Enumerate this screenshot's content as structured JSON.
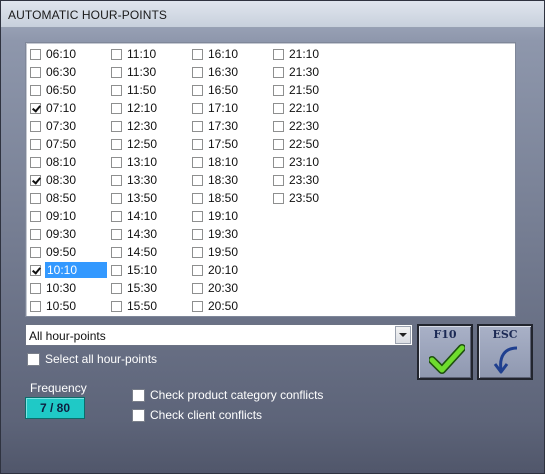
{
  "window": {
    "title": "AUTOMATIC HOUR-POINTS"
  },
  "hour_points": {
    "columns": [
      [
        {
          "time": "06:10",
          "checked": false
        },
        {
          "time": "06:30",
          "checked": false
        },
        {
          "time": "06:50",
          "checked": false
        },
        {
          "time": "07:10",
          "checked": true
        },
        {
          "time": "07:30",
          "checked": false
        },
        {
          "time": "07:50",
          "checked": false
        },
        {
          "time": "08:10",
          "checked": false
        },
        {
          "time": "08:30",
          "checked": true
        },
        {
          "time": "08:50",
          "checked": false
        },
        {
          "time": "09:10",
          "checked": false
        },
        {
          "time": "09:30",
          "checked": false
        },
        {
          "time": "09:50",
          "checked": false
        },
        {
          "time": "10:10",
          "checked": true,
          "selected": true
        },
        {
          "time": "10:30",
          "checked": false
        },
        {
          "time": "10:50",
          "checked": false
        }
      ],
      [
        {
          "time": "11:10",
          "checked": false
        },
        {
          "time": "11:30",
          "checked": false
        },
        {
          "time": "11:50",
          "checked": false
        },
        {
          "time": "12:10",
          "checked": false
        },
        {
          "time": "12:30",
          "checked": false
        },
        {
          "time": "12:50",
          "checked": false
        },
        {
          "time": "13:10",
          "checked": false
        },
        {
          "time": "13:30",
          "checked": false
        },
        {
          "time": "13:50",
          "checked": false
        },
        {
          "time": "14:10",
          "checked": false
        },
        {
          "time": "14:30",
          "checked": false
        },
        {
          "time": "14:50",
          "checked": false
        },
        {
          "time": "15:10",
          "checked": false
        },
        {
          "time": "15:30",
          "checked": false
        },
        {
          "time": "15:50",
          "checked": false
        }
      ],
      [
        {
          "time": "16:10",
          "checked": false
        },
        {
          "time": "16:30",
          "checked": false
        },
        {
          "time": "16:50",
          "checked": false
        },
        {
          "time": "17:10",
          "checked": false
        },
        {
          "time": "17:30",
          "checked": false
        },
        {
          "time": "17:50",
          "checked": false
        },
        {
          "time": "18:10",
          "checked": false
        },
        {
          "time": "18:30",
          "checked": false
        },
        {
          "time": "18:50",
          "checked": false
        },
        {
          "time": "19:10",
          "checked": false
        },
        {
          "time": "19:30",
          "checked": false
        },
        {
          "time": "19:50",
          "checked": false
        },
        {
          "time": "20:10",
          "checked": false
        },
        {
          "time": "20:30",
          "checked": false
        },
        {
          "time": "20:50",
          "checked": false
        }
      ],
      [
        {
          "time": "21:10",
          "checked": false
        },
        {
          "time": "21:30",
          "checked": false
        },
        {
          "time": "21:50",
          "checked": false
        },
        {
          "time": "22:10",
          "checked": false
        },
        {
          "time": "22:30",
          "checked": false
        },
        {
          "time": "22:50",
          "checked": false
        },
        {
          "time": "23:10",
          "checked": false
        },
        {
          "time": "23:30",
          "checked": false
        },
        {
          "time": "23:50",
          "checked": false
        }
      ]
    ]
  },
  "filter": {
    "selected": "All hour-points"
  },
  "select_all": {
    "label": "Select all hour-points",
    "checked": false
  },
  "frequency": {
    "label": "Frequency",
    "value": "7 / 80"
  },
  "options": {
    "product_conflicts": {
      "label": "Check product category conflicts",
      "checked": false
    },
    "client_conflicts": {
      "label": "Check client conflicts",
      "checked": false
    }
  },
  "buttons": {
    "ok": {
      "key": "F10",
      "icon": "checkmark-icon",
      "icon_color": "#5fcf2a"
    },
    "cancel": {
      "key": "ESC",
      "icon": "undo-arrow-icon",
      "icon_color": "#1f3f8f"
    }
  }
}
